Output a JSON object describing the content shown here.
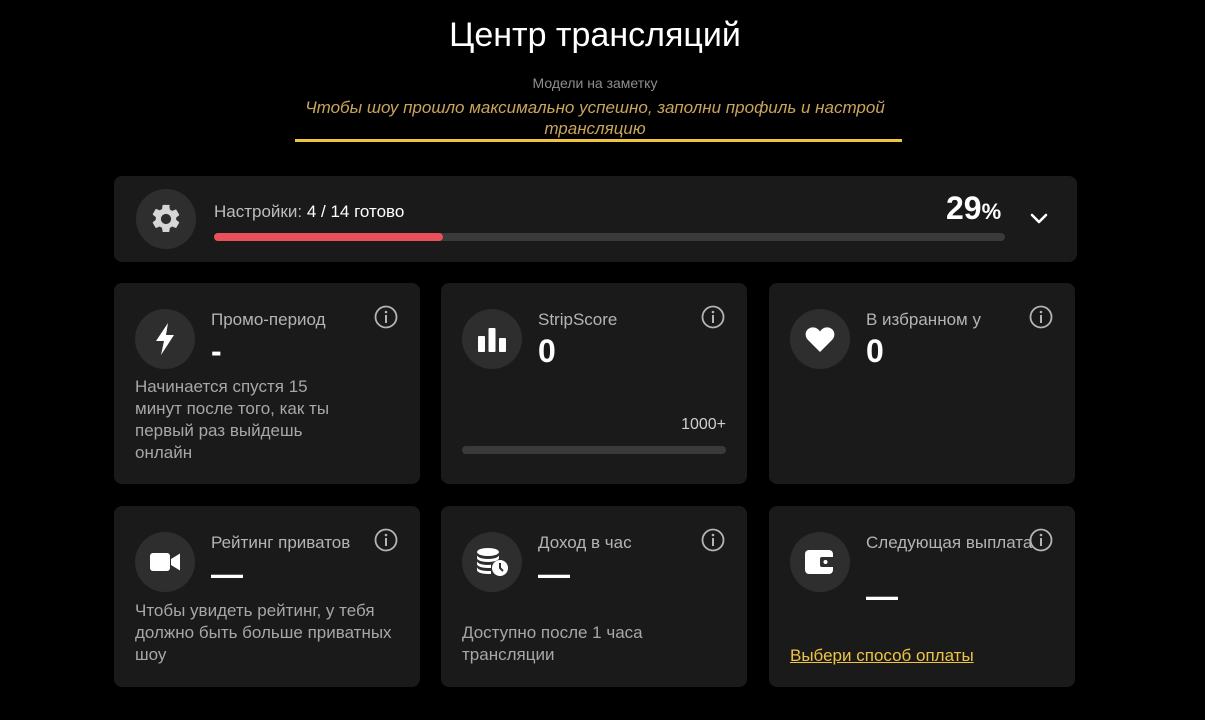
{
  "header": {
    "title": "Центр трансляций",
    "subtitle": "Модели на заметку",
    "notice": "Чтобы шоу прошло максимально успешно, заполни профиль и настрой трансляцию"
  },
  "settings": {
    "label": "Настройки:",
    "status": "4 / 14 готово",
    "percent_value": "29",
    "percent_sign": "%",
    "progress_fraction": 0.29
  },
  "cards": {
    "promo": {
      "title": "Промо-период",
      "value": "-",
      "description": "Начинается спустя 15 минут после того, как ты первый раз выйдешь онлайн"
    },
    "stripscore": {
      "title": "StripScore",
      "value": "0",
      "target": "1000+",
      "progress_fraction": 0
    },
    "favorites": {
      "title": "В избранном у",
      "value": "0"
    },
    "private_rating": {
      "title": "Рейтинг приватов",
      "value": "—",
      "description": "Чтобы увидеть рейтинг, у тебя должно быть больше приватных шоу"
    },
    "hourly_income": {
      "title": "Доход в час",
      "value": "—",
      "description": "Доступно после 1 часа трансляции"
    },
    "next_payout": {
      "title": "Следующая выплата",
      "value": "—",
      "link": "Выбери способ оплаты"
    }
  },
  "colors": {
    "accent_gold": "#f0c343",
    "progress_red": "#e8505b",
    "card_bg": "#1a1a1a"
  }
}
